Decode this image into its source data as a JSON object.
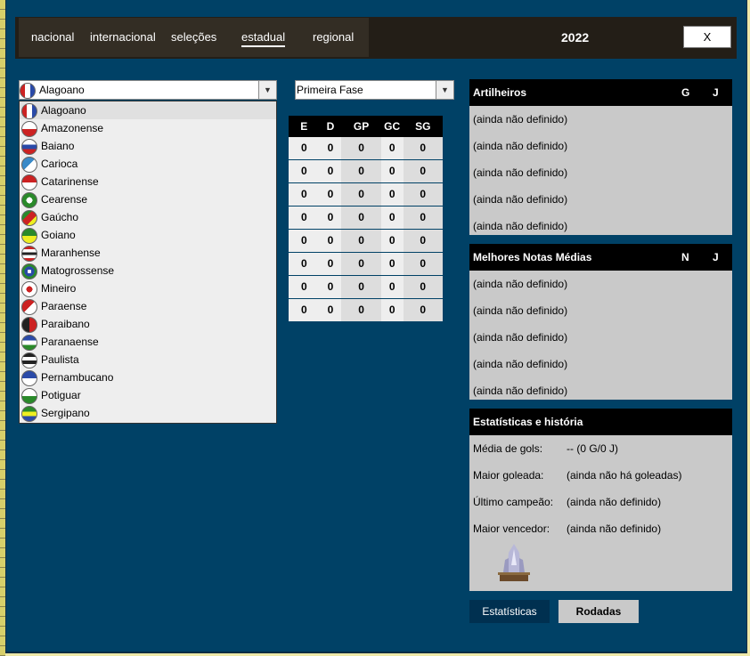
{
  "nav": [
    "nacional",
    "internacional",
    "seleções",
    "estadual",
    "regional"
  ],
  "active_nav": "estadual",
  "year": "2022",
  "close_label": "X",
  "state_select": {
    "value": "Alagoano"
  },
  "phase_select": {
    "value": "Primeira Fase"
  },
  "dropdown_items": [
    "Alagoano",
    "Amazonense",
    "Baiano",
    "Carioca",
    "Catarinense",
    "Cearense",
    "Gaúcho",
    "Goiano",
    "Maranhense",
    "Matogrossense",
    "Mineiro",
    "Paraense",
    "Paraibano",
    "Paranaense",
    "Paulista",
    "Pernambucano",
    "Potiguar",
    "Sergipano"
  ],
  "standings": {
    "headers": [
      "E",
      "D",
      "GP",
      "GC",
      "SG"
    ],
    "rows": [
      [
        "0",
        "0",
        "0",
        "0",
        "0"
      ],
      [
        "0",
        "0",
        "0",
        "0",
        "0"
      ],
      [
        "0",
        "0",
        "0",
        "0",
        "0"
      ],
      [
        "0",
        "0",
        "0",
        "0",
        "0"
      ],
      [
        "0",
        "0",
        "0",
        "0",
        "0"
      ],
      [
        "0",
        "0",
        "0",
        "0",
        "0"
      ],
      [
        "0",
        "0",
        "0",
        "0",
        "0"
      ],
      [
        "0",
        "0",
        "0",
        "0",
        "0"
      ]
    ]
  },
  "artilheiros": {
    "title": "Artilheiros",
    "col1": "G",
    "col2": "J",
    "rows": [
      "(ainda não definido)",
      "(ainda não definido)",
      "(ainda não definido)",
      "(ainda não definido)",
      "(ainda não definido)"
    ]
  },
  "notas": {
    "title": "Melhores Notas Médias",
    "col1": "N",
    "col2": "J",
    "rows": [
      "(ainda não definido)",
      "(ainda não definido)",
      "(ainda não definido)",
      "(ainda não definido)",
      "(ainda não definido)"
    ]
  },
  "estatisticas": {
    "title": "Estatísticas e história",
    "rows": [
      {
        "label": "Média de gols:",
        "value": "-- (0 G/0 J)"
      },
      {
        "label": "Maior goleada:",
        "value": "(ainda não há goleadas)"
      },
      {
        "label": "Último campeão:",
        "value": "(ainda não definido)"
      },
      {
        "label": "Maior vencedor:",
        "value": "(ainda não definido)"
      }
    ]
  },
  "tabs": {
    "stats": "Estatísticas",
    "rounds": "Rodadas"
  },
  "colors": {
    "bg": "#004166",
    "topbar": "#231e17",
    "panel": "#c9c9c9"
  }
}
